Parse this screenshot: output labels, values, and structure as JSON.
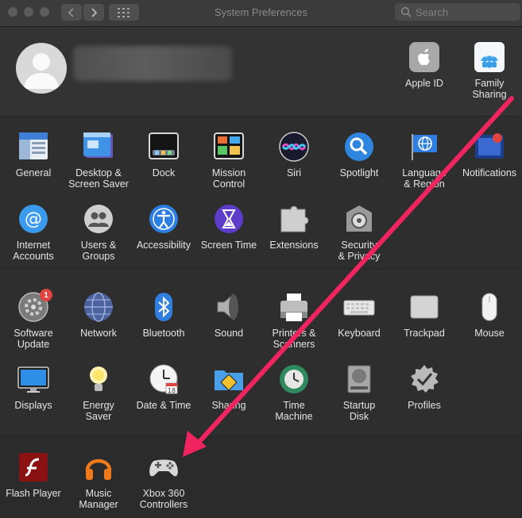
{
  "window": {
    "title": "System Preferences"
  },
  "search": {
    "placeholder": "Search"
  },
  "account": {
    "apple_id": "Apple ID",
    "family_sharing": "Family\nSharing"
  },
  "personal": [
    {
      "label": "General",
      "icon": "general-icon"
    },
    {
      "label": "Desktop &\nScreen Saver",
      "icon": "desktop-icon"
    },
    {
      "label": "Dock",
      "icon": "dock-icon"
    },
    {
      "label": "Mission\nControl",
      "icon": "mission-control-icon"
    },
    {
      "label": "Siri",
      "icon": "siri-icon"
    },
    {
      "label": "Spotlight",
      "icon": "spotlight-icon"
    },
    {
      "label": "Language\n& Region",
      "icon": "language-icon"
    },
    {
      "label": "Notifications",
      "icon": "notifications-icon"
    },
    {
      "label": "Internet\nAccounts",
      "icon": "internet-accounts-icon"
    },
    {
      "label": "Users &\nGroups",
      "icon": "users-icon"
    },
    {
      "label": "Accessibility",
      "icon": "accessibility-icon"
    },
    {
      "label": "Screen Time",
      "icon": "screen-time-icon"
    },
    {
      "label": "Extensions",
      "icon": "extensions-icon"
    },
    {
      "label": "Security\n& Privacy",
      "icon": "security-icon"
    }
  ],
  "hardware": [
    {
      "label": "Software\nUpdate",
      "icon": "software-update-icon",
      "badge": "1"
    },
    {
      "label": "Network",
      "icon": "network-icon"
    },
    {
      "label": "Bluetooth",
      "icon": "bluetooth-icon"
    },
    {
      "label": "Sound",
      "icon": "sound-icon"
    },
    {
      "label": "Printers &\nScanners",
      "icon": "printer-icon"
    },
    {
      "label": "Keyboard",
      "icon": "keyboard-icon"
    },
    {
      "label": "Trackpad",
      "icon": "trackpad-icon"
    },
    {
      "label": "Mouse",
      "icon": "mouse-icon"
    },
    {
      "label": "Displays",
      "icon": "displays-icon"
    },
    {
      "label": "Energy\nSaver",
      "icon": "energy-saver-icon"
    },
    {
      "label": "Date & Time",
      "icon": "date-time-icon"
    },
    {
      "label": "Sharing",
      "icon": "sharing-icon"
    },
    {
      "label": "Time\nMachine",
      "icon": "time-machine-icon"
    },
    {
      "label": "Startup\nDisk",
      "icon": "startup-disk-icon"
    },
    {
      "label": "Profiles",
      "icon": "profiles-icon"
    }
  ],
  "other": [
    {
      "label": "Flash Player",
      "icon": "flash-icon"
    },
    {
      "label": "Music\nManager",
      "icon": "headphones-icon"
    },
    {
      "label": "Xbox 360\nControllers",
      "icon": "gamepad-icon"
    }
  ],
  "colors": {
    "annotation_arrow": "#f0245e"
  }
}
